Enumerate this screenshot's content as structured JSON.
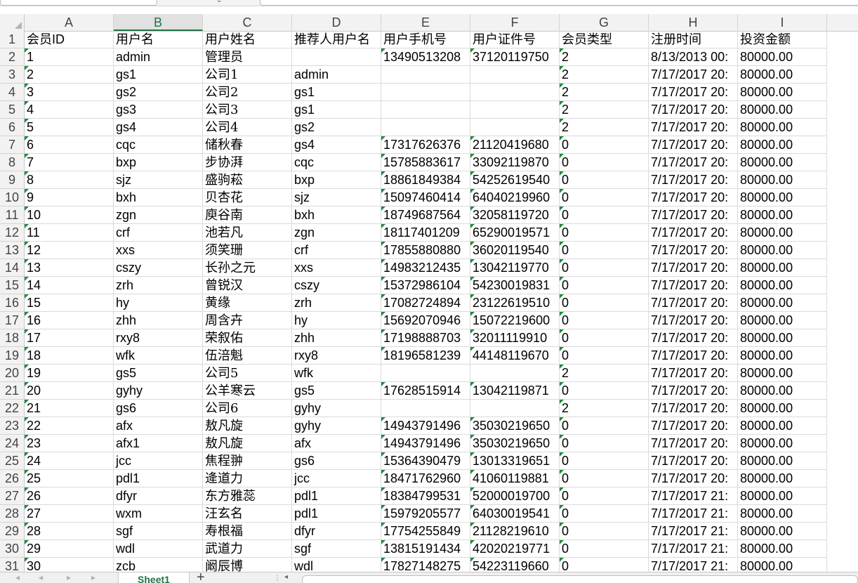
{
  "toolbar": {
    "dropdown_glyph": "⌄"
  },
  "columns": [
    {
      "letter": "A",
      "width": 127
    },
    {
      "letter": "B",
      "width": 127
    },
    {
      "letter": "C",
      "width": 127
    },
    {
      "letter": "D",
      "width": 127
    },
    {
      "letter": "E",
      "width": 127
    },
    {
      "letter": "F",
      "width": 127
    },
    {
      "letter": "G",
      "width": 127
    },
    {
      "letter": "H",
      "width": 127
    },
    {
      "letter": "I",
      "width": 127
    }
  ],
  "selected_column": "B",
  "header_row": [
    "会员ID",
    "用户名",
    "用户姓名",
    "推荐人用户名",
    "用户手机号",
    "用户证件号",
    "会员类型",
    "注册时间",
    "投资金额"
  ],
  "rows": [
    [
      "1",
      "admin",
      "管理员",
      "",
      "13490513208",
      "37120119750",
      "2",
      "8/13/2013 00:",
      "80000.00"
    ],
    [
      "2",
      "gs1",
      "公司1",
      "admin",
      "",
      "",
      "2",
      "7/17/2017 20:",
      "80000.00"
    ],
    [
      "3",
      "gs2",
      "公司2",
      "gs1",
      "",
      "",
      "2",
      "7/17/2017 20:",
      "80000.00"
    ],
    [
      "4",
      "gs3",
      "公司3",
      "gs1",
      "",
      "",
      "2",
      "7/17/2017 20:",
      "80000.00"
    ],
    [
      "5",
      "gs4",
      "公司4",
      "gs2",
      "",
      "",
      "2",
      "7/17/2017 20:",
      "80000.00"
    ],
    [
      "6",
      "cqc",
      "储秋春",
      "gs4",
      "17317626376",
      "21120419680",
      "0",
      "7/17/2017 20:",
      "80000.00"
    ],
    [
      "7",
      "bxp",
      "步协湃",
      "cqc",
      "15785883617",
      "33092119870",
      "0",
      "7/17/2017 20:",
      "80000.00"
    ],
    [
      "8",
      "sjz",
      "盛驹菘",
      "bxp",
      "18861849384",
      "54252619540",
      "0",
      "7/17/2017 20:",
      "80000.00"
    ],
    [
      "9",
      "bxh",
      "贝杏花",
      "sjz",
      "15097460414",
      "64040219960",
      "0",
      "7/17/2017 20:",
      "80000.00"
    ],
    [
      "10",
      "zgn",
      "庾谷南",
      "bxh",
      "18749687564",
      "32058119720",
      "0",
      "7/17/2017 20:",
      "80000.00"
    ],
    [
      "11",
      "crf",
      "池若凡",
      "zgn",
      "18117401209",
      "65290019571",
      "0",
      "7/17/2017 20:",
      "80000.00"
    ],
    [
      "12",
      "xxs",
      "须笑珊",
      "crf",
      "17855880880",
      "36020119540",
      "0",
      "7/17/2017 20:",
      "80000.00"
    ],
    [
      "13",
      "cszy",
      "长孙之元",
      "xxs",
      "14983212435",
      "13042119770",
      "0",
      "7/17/2017 20:",
      "80000.00"
    ],
    [
      "14",
      "zrh",
      "曾锐汉",
      "cszy",
      "15372986104",
      "54230019831",
      "0",
      "7/17/2017 20:",
      "80000.00"
    ],
    [
      "15",
      "hy",
      "黄缘",
      "zrh",
      "17082724894",
      "23122619510",
      "0",
      "7/17/2017 20:",
      "80000.00"
    ],
    [
      "16",
      "zhh",
      "周含卉",
      "hy",
      "15692070946",
      "15072219600",
      "0",
      "7/17/2017 20:",
      "80000.00"
    ],
    [
      "17",
      "rxy8",
      "荣叙佑",
      "zhh",
      "17198888703",
      "32011119910",
      "0",
      "7/17/2017 20:",
      "80000.00"
    ],
    [
      "18",
      "wfk",
      "伍涪魁",
      "rxy8",
      "18196581239",
      "44148119670",
      "0",
      "7/17/2017 20:",
      "80000.00"
    ],
    [
      "19",
      "gs5",
      "公司5",
      "wfk",
      "",
      "",
      "2",
      "7/17/2017 20:",
      "80000.00"
    ],
    [
      "20",
      "gyhy",
      "公羊寒云",
      "gs5",
      "17628515914",
      "13042119871",
      "0",
      "7/17/2017 20:",
      "80000.00"
    ],
    [
      "21",
      "gs6",
      "公司6",
      "gyhy",
      "",
      "",
      "2",
      "7/17/2017 20:",
      "80000.00"
    ],
    [
      "22",
      "afx",
      "敖凡旋",
      "gyhy",
      "14943791496",
      "35030219650",
      "0",
      "7/17/2017 20:",
      "80000.00"
    ],
    [
      "23",
      "afx1",
      "敖凡旋",
      "afx",
      "14943791496",
      "35030219650",
      "0",
      "7/17/2017 20:",
      "80000.00"
    ],
    [
      "24",
      "jcc",
      "焦程翀",
      "gs6",
      "15364390479",
      "13013319651",
      "0",
      "7/17/2017 20:",
      "80000.00"
    ],
    [
      "25",
      "pdl1",
      "逄道力",
      "jcc",
      "18471762960",
      "41060119881",
      "0",
      "7/17/2017 20:",
      "80000.00"
    ],
    [
      "26",
      "dfyr",
      "东方雅蕊",
      "pdl1",
      "18384799531",
      "52000019700",
      "0",
      "7/17/2017 21:",
      "80000.00"
    ],
    [
      "27",
      "wxm",
      "汪玄名",
      "pdl1",
      "15979205577",
      "64030019541",
      "0",
      "7/17/2017 21:",
      "80000.00"
    ],
    [
      "28",
      "sgf",
      "寿根福",
      "dfyr",
      "17754255849",
      "21128219610",
      "0",
      "7/17/2017 21:",
      "80000.00"
    ],
    [
      "29",
      "wdl",
      "武道力",
      "sgf",
      "13815191434",
      "42020219771",
      "0",
      "7/17/2017 21:",
      "80000.00"
    ],
    [
      "30",
      "zcb",
      "阚辰博",
      "wdl",
      "17827148275",
      "54223119660",
      "0",
      "7/17/2017 21:",
      "80000.00"
    ]
  ],
  "sheets": [
    {
      "name": "Sheet1",
      "active": true
    }
  ],
  "bottom": {
    "add_sheet_glyph": "+",
    "separator_glyph": "⋮",
    "scroll_left_glyph": "◂",
    "nav_glyphs": [
      "◂",
      "◂",
      "▸",
      "▸"
    ]
  }
}
